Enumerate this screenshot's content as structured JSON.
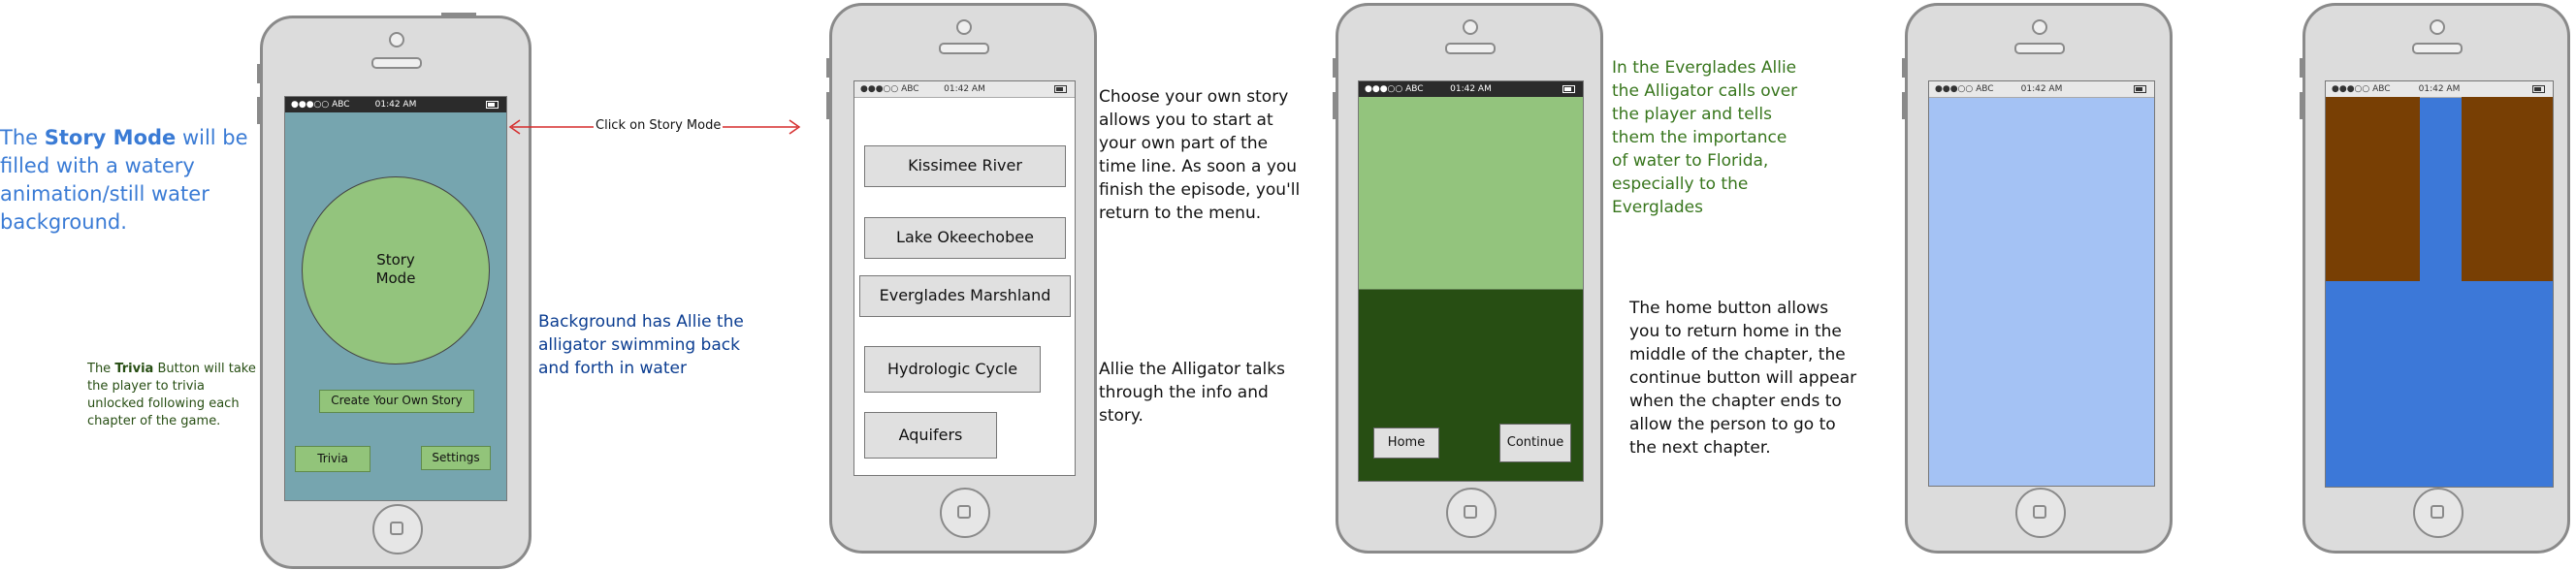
{
  "status_bar": {
    "carrier": "●●●○○ ABC",
    "time": "01:42 AM"
  },
  "annotations": {
    "story_mode_note": {
      "before": "The ",
      "bold": "Story Mode",
      "after": " will be filled with a watery animation/still water background."
    },
    "trivia_note": {
      "before": "The ",
      "bold": "Trivia",
      "after": " Button will take the player to trivia unlocked following each chapter of the game."
    },
    "background_note": "Background has Allie the alligator swimming back and forth in water",
    "arrow_label": "Click on Story Mode",
    "choose_story_note": "Choose your own story allows you to start at your own part of the time line. As soon a you finish the episode, you'll return to the menu.",
    "allie_talks_note": "Allie the Alligator talks through the info and story.",
    "everglades_note": "In the Everglades Allie the Alligator calls over the player and tells them the importance of water to Florida, especially to the Everglades",
    "home_button_note": "The home button allows you to return home in the middle of the chapter, the continue button will appear when the chapter ends to allow the person to go to the next chapter."
  },
  "screen1": {
    "story_mode_label": "Story Mode",
    "create_story_label": "Create Your Own Story",
    "trivia_label": "Trivia",
    "settings_label": "Settings"
  },
  "screen2": {
    "menu_items": [
      "Kissimee River",
      "Lake Okeechobee",
      "Everglades Marshland",
      "Hydrologic Cycle",
      "Aquifers"
    ]
  },
  "screen3": {
    "home_label": "Home",
    "continue_label": "Continue"
  },
  "colors": {
    "accent_blue": "#3a7bd5",
    "water_teal": "#76a5af",
    "light_green": "#93c47d",
    "dark_green": "#274e13",
    "light_blue": "#a4c2f4",
    "mid_blue": "#3c78d8",
    "brown": "#783f04",
    "note_green": "#38761d",
    "note_navy": "#0b3d91"
  }
}
